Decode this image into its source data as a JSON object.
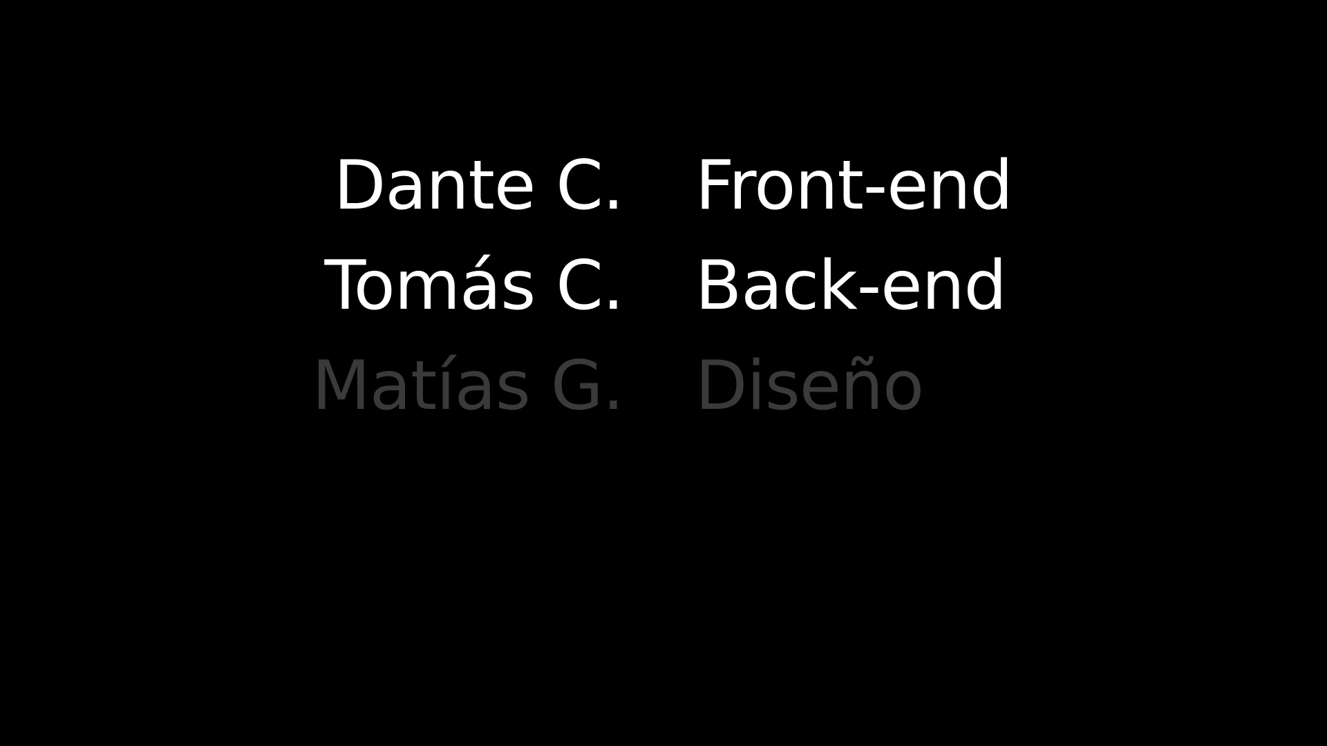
{
  "credits": [
    {
      "name": "Dante C.",
      "role": "Front-end",
      "state": "active"
    },
    {
      "name": "Tomás C.",
      "role": "Back-end",
      "state": "active"
    },
    {
      "name": "Matías G.",
      "role": "Diseño",
      "state": "dim"
    }
  ],
  "colors": {
    "background": "#000000",
    "active_text": "#ffffff",
    "dim_text": "#3a3a3a"
  }
}
